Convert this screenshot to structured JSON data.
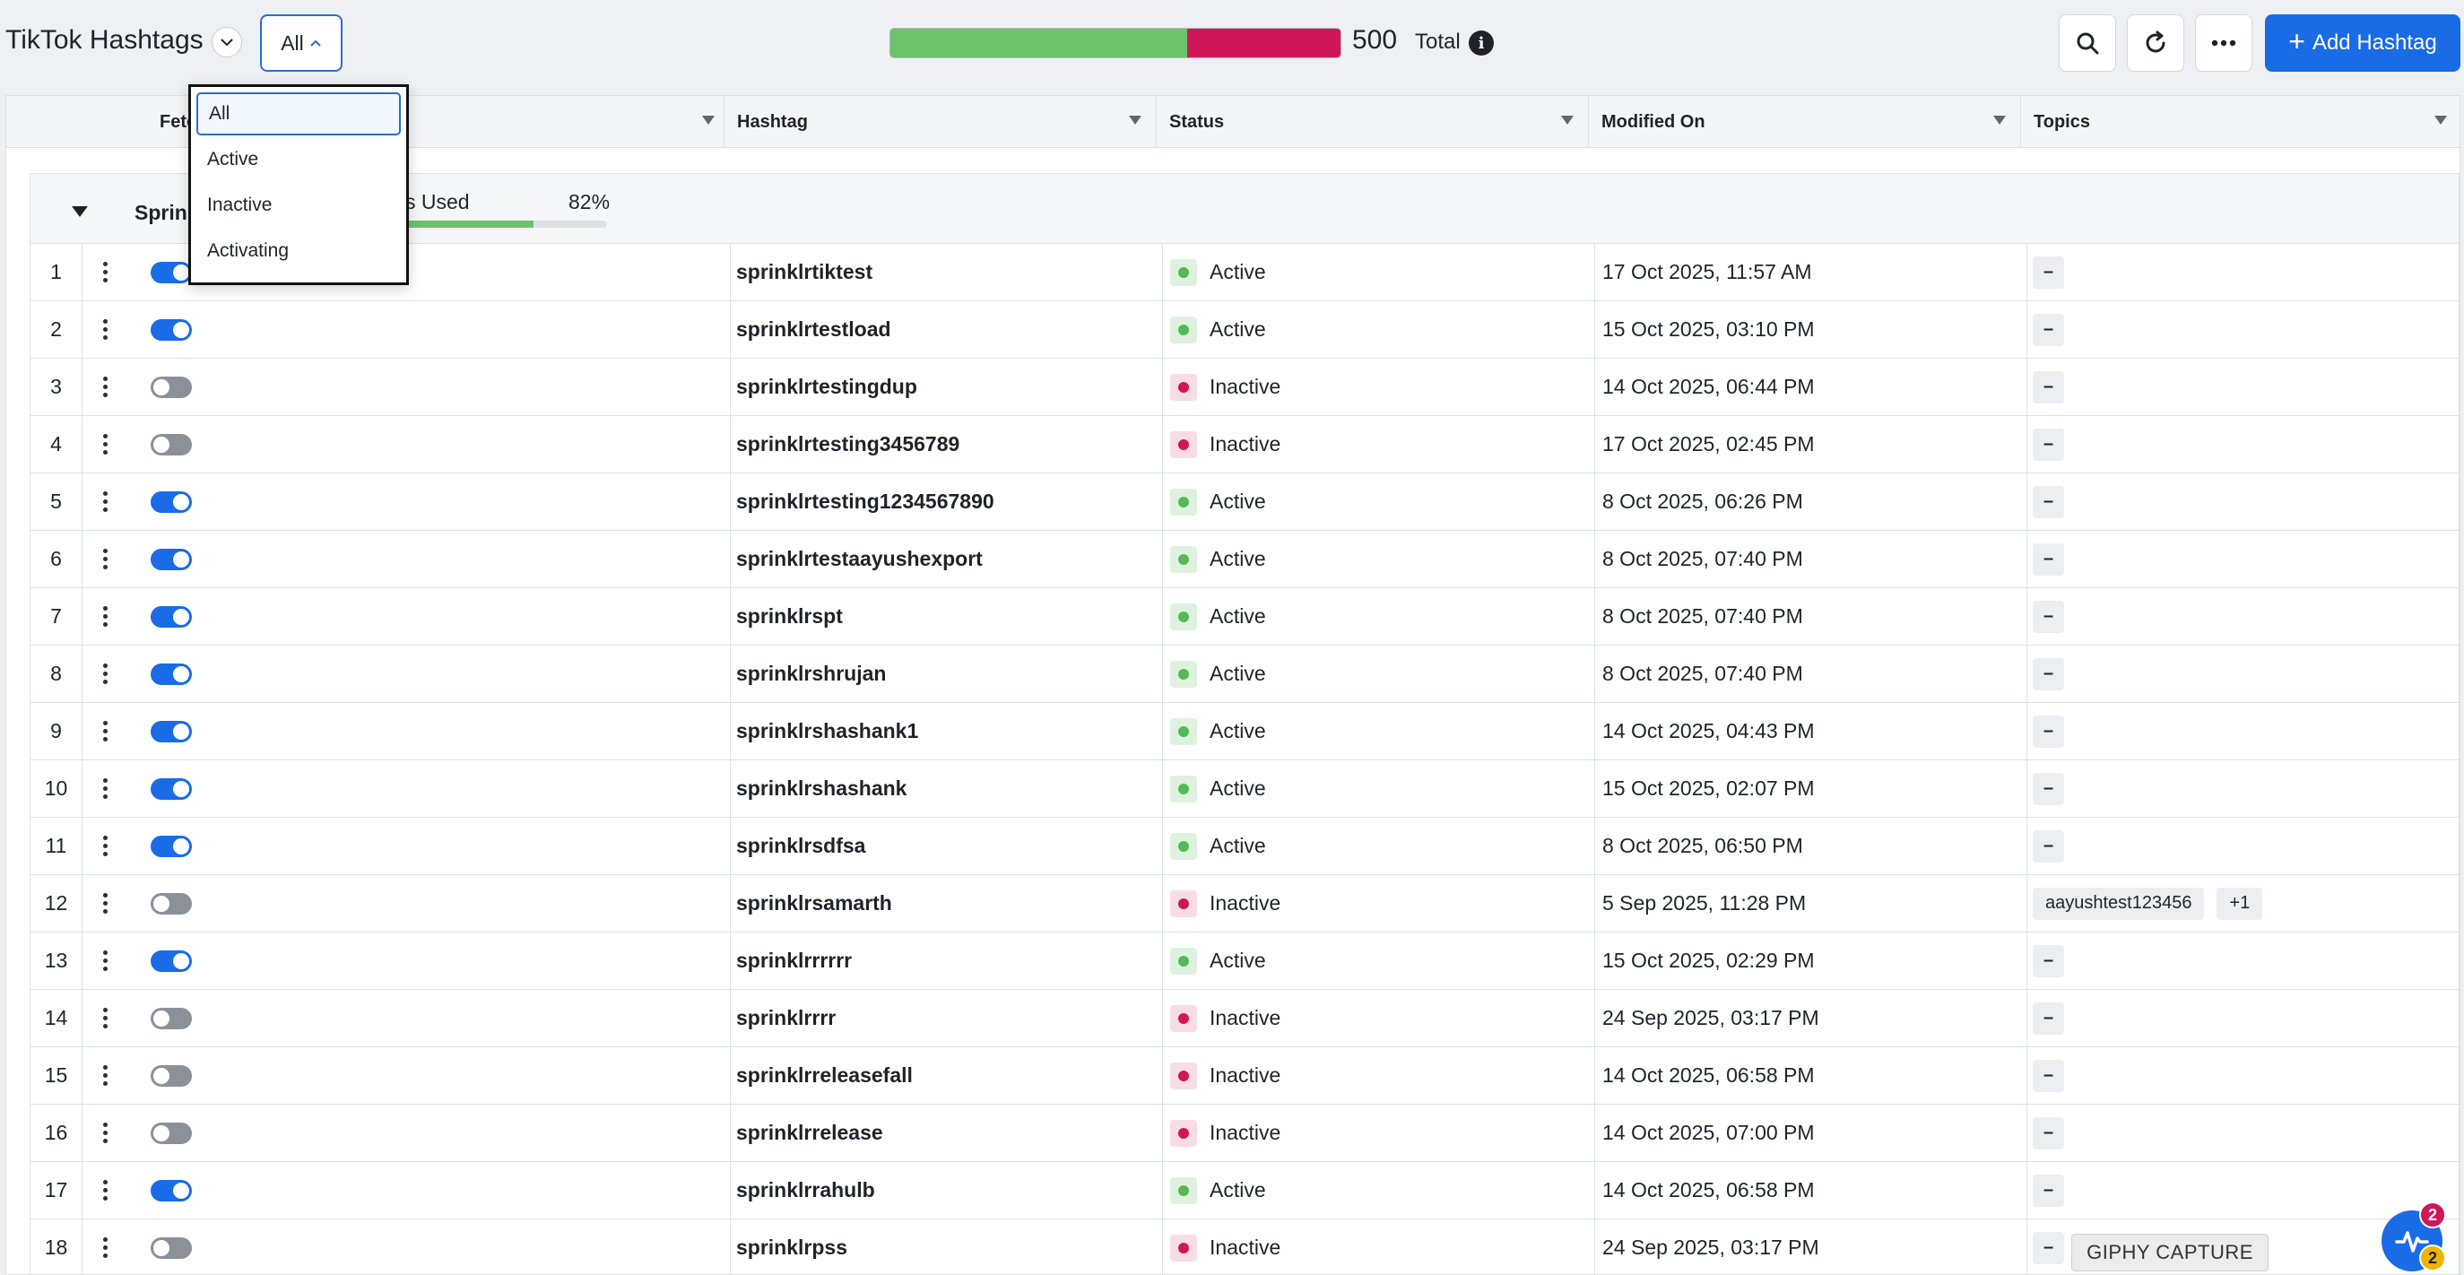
{
  "header": {
    "title": "TikTok Hashtags",
    "filter_value": "All",
    "status_bar": {
      "active_fraction": 0.66,
      "active_color": "#6cc36c",
      "inactive_color": "#cf1757"
    },
    "total_count": "500",
    "total_label": "Total",
    "info_glyph": "i",
    "add_button_label": "Add Hashtag",
    "icons": [
      "chevron-down-icon",
      "chevron-up-icon",
      "info-icon",
      "search-icon",
      "refresh-icon",
      "more-icon",
      "plus-icon"
    ]
  },
  "dropdown": {
    "options": [
      "All",
      "Active",
      "Inactive",
      "Activating"
    ],
    "selected": "All"
  },
  "columns": {
    "fetch": "Fetch",
    "hashtag": "Hashtag",
    "status": "Status",
    "modified": "Modified On",
    "topics": "Topics"
  },
  "group": {
    "name": "Sprinklr",
    "usage_label": "s Used",
    "usage_percent": "82%",
    "usage_fraction": 0.82
  },
  "rows": [
    {
      "num": "1",
      "on": true,
      "hashtag": "sprinklrtiktest",
      "status": "Active",
      "modified": "17 Oct 2025, 11:57 AM",
      "topics": [
        "–"
      ]
    },
    {
      "num": "2",
      "on": true,
      "hashtag": "sprinklrtestload",
      "status": "Active",
      "modified": "15 Oct 2025, 03:10 PM",
      "topics": [
        "–"
      ]
    },
    {
      "num": "3",
      "on": false,
      "hashtag": "sprinklrtestingdup",
      "status": "Inactive",
      "modified": "14 Oct 2025, 06:44 PM",
      "topics": [
        "–"
      ]
    },
    {
      "num": "4",
      "on": false,
      "hashtag": "sprinklrtesting3456789",
      "status": "Inactive",
      "modified": "17 Oct 2025, 02:45 PM",
      "topics": [
        "–"
      ]
    },
    {
      "num": "5",
      "on": true,
      "hashtag": "sprinklrtesting1234567890",
      "status": "Active",
      "modified": "8 Oct 2025, 06:26 PM",
      "topics": [
        "–"
      ]
    },
    {
      "num": "6",
      "on": true,
      "hashtag": "sprinklrtestaayushexport",
      "status": "Active",
      "modified": "8 Oct 2025, 07:40 PM",
      "topics": [
        "–"
      ]
    },
    {
      "num": "7",
      "on": true,
      "hashtag": "sprinklrspt",
      "status": "Active",
      "modified": "8 Oct 2025, 07:40 PM",
      "topics": [
        "–"
      ]
    },
    {
      "num": "8",
      "on": true,
      "hashtag": "sprinklrshrujan",
      "status": "Active",
      "modified": "8 Oct 2025, 07:40 PM",
      "topics": [
        "–"
      ]
    },
    {
      "num": "9",
      "on": true,
      "hashtag": "sprinklrshashank1",
      "status": "Active",
      "modified": "14 Oct 2025, 04:43 PM",
      "topics": [
        "–"
      ]
    },
    {
      "num": "10",
      "on": true,
      "hashtag": "sprinklrshashank",
      "status": "Active",
      "modified": "15 Oct 2025, 02:07 PM",
      "topics": [
        "–"
      ]
    },
    {
      "num": "11",
      "on": true,
      "hashtag": "sprinklrsdfsa",
      "status": "Active",
      "modified": "8 Oct 2025, 06:50 PM",
      "topics": [
        "–"
      ]
    },
    {
      "num": "12",
      "on": false,
      "hashtag": "sprinklrsamarth",
      "status": "Inactive",
      "modified": "5 Sep 2025, 11:28 PM",
      "topics": [
        "aayushtest123456",
        "+1"
      ]
    },
    {
      "num": "13",
      "on": true,
      "hashtag": "sprinklrrrrrr",
      "status": "Active",
      "modified": "15 Oct 2025, 02:29 PM",
      "topics": [
        "–"
      ]
    },
    {
      "num": "14",
      "on": false,
      "hashtag": "sprinklrrrr",
      "status": "Inactive",
      "modified": "24 Sep 2025, 03:17 PM",
      "topics": [
        "–"
      ]
    },
    {
      "num": "15",
      "on": false,
      "hashtag": "sprinklrreleasefall",
      "status": "Inactive",
      "modified": "14 Oct 2025, 06:58 PM",
      "topics": [
        "–"
      ]
    },
    {
      "num": "16",
      "on": false,
      "hashtag": "sprinklrrelease",
      "status": "Inactive",
      "modified": "14 Oct 2025, 07:00 PM",
      "topics": [
        "–"
      ]
    },
    {
      "num": "17",
      "on": true,
      "hashtag": "sprinklrrahulb",
      "status": "Active",
      "modified": "14 Oct 2025, 06:58 PM",
      "topics": [
        "–"
      ]
    },
    {
      "num": "18",
      "on": false,
      "hashtag": "sprinklrpss",
      "status": "Inactive",
      "modified": "24 Sep 2025, 03:17 PM",
      "topics": [
        "–"
      ]
    }
  ],
  "widgets": {
    "giphy_label": "GIPHY CAPTURE",
    "badge_top": "2",
    "badge_bottom": "2"
  }
}
